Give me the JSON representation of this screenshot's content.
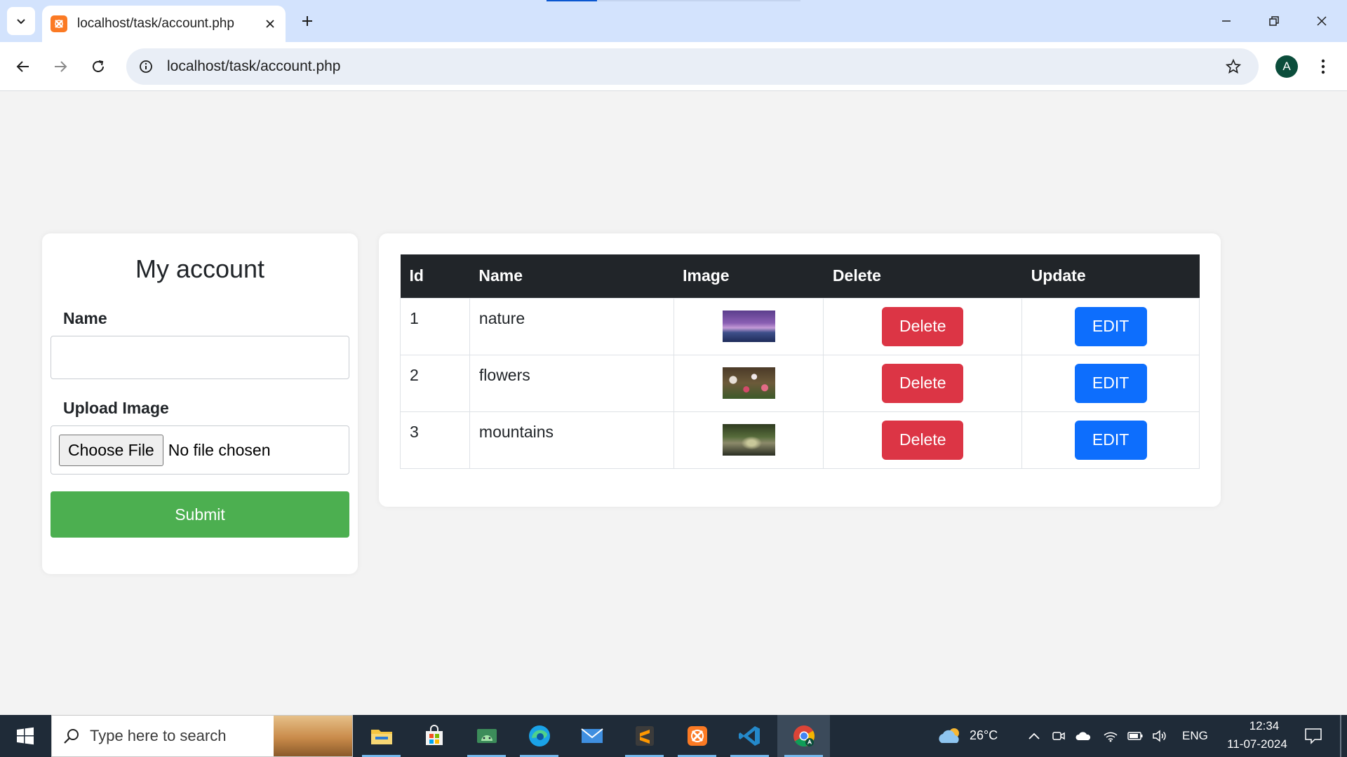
{
  "browser": {
    "tab_title": "localhost/task/account.php",
    "url": "localhost/task/account.php",
    "profile_initial": "A"
  },
  "form": {
    "title": "My account",
    "name_label": "Name",
    "name_value": "",
    "upload_label": "Upload Image",
    "choose_file_label": "Choose File",
    "file_status": "No file chosen",
    "submit_label": "Submit"
  },
  "table": {
    "headers": [
      "Id",
      "Name",
      "Image",
      "Delete",
      "Update"
    ],
    "rows": [
      {
        "id": "1",
        "name": "nature",
        "delete_label": "Delete",
        "edit_label": "EDIT"
      },
      {
        "id": "2",
        "name": "flowers",
        "delete_label": "Delete",
        "edit_label": "EDIT"
      },
      {
        "id": "3",
        "name": "mountains",
        "delete_label": "Delete",
        "edit_label": "EDIT"
      }
    ]
  },
  "taskbar": {
    "search_placeholder": "Type here to search",
    "apps": [
      "file-explorer-icon",
      "microsoft-store-icon",
      "android-studio-icon",
      "edge-icon",
      "mail-icon",
      "sublime-text-icon",
      "xampp-icon",
      "vscode-icon",
      "chrome-icon"
    ],
    "weather": "26°C",
    "language": "ENG",
    "time": "12:34",
    "date": "11-07-2024"
  },
  "colors": {
    "delete": "#dc3545",
    "edit": "#0d6efd",
    "submit": "#4caf50",
    "table_header": "#212529",
    "tabstrip": "#d3e3fd"
  }
}
